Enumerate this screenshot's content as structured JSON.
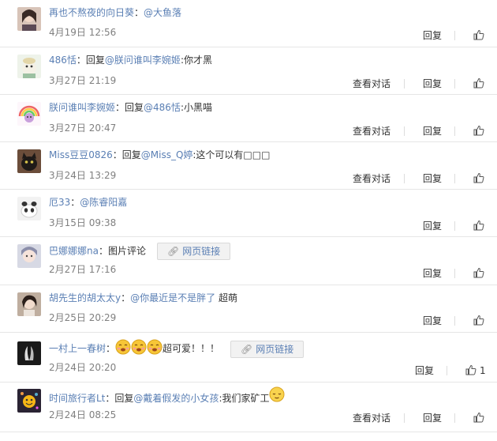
{
  "comments": [
    {
      "user": "再也不熬夜的向日葵",
      "sep": "：",
      "mention": "@大鱼落",
      "after": "",
      "time": "4月19日 12:56",
      "reply": "回复",
      "like_count": ""
    },
    {
      "user": "486恬",
      "sep": "：回复",
      "mention": "@朕问谁叫李婉姬",
      "after": ":你才黑",
      "time": "3月27日 21:19",
      "view": "查看对话",
      "reply": "回复",
      "like_count": ""
    },
    {
      "user": "朕问谁叫李婉姬",
      "sep": "：回复",
      "mention": "@486恬",
      "after": ":小黑喵",
      "time": "3月27日 20:47",
      "view": "查看对话",
      "reply": "回复",
      "like_count": ""
    },
    {
      "user": "Miss豆豆0826",
      "sep": "：回复",
      "mention": "@Miss_Q婷",
      "after": ":这个可以有□□□",
      "time": "3月24日 13:29",
      "view": "查看对话",
      "reply": "回复",
      "like_count": ""
    },
    {
      "user": "厄33",
      "sep": "：",
      "mention": "@陈睿阳嘉",
      "after": "",
      "time": "3月15日 09:38",
      "reply": "回复",
      "like_count": ""
    },
    {
      "user": "巴娜娜娜na",
      "sep": "：图片评论",
      "mention": "",
      "after": "",
      "link": "网页链接",
      "time": "2月27日 17:16",
      "reply": "回复",
      "like_count": ""
    },
    {
      "user": "胡先生的胡太太y",
      "sep": "：",
      "mention": "@你最近是不是胖了",
      "after": " 超萌",
      "time": "2月25日 20:29",
      "reply": "回复",
      "like_count": ""
    },
    {
      "user": "一村上一春树",
      "sep": "：",
      "mention": "",
      "after": "超可爱！！！",
      "link": "网页链接",
      "time": "2月24日 20:20",
      "reply": "回复",
      "like_count": "1"
    },
    {
      "user": "时间旅行者Lt",
      "sep": "：回复",
      "mention": "@戴着假发的小女孩",
      "after": ":我们家矿工",
      "time": "2月24日 08:25",
      "view": "查看对话",
      "reply": "回复",
      "like_count": ""
    }
  ],
  "colors": {
    "link": "#5a7fb4",
    "time": "#808080",
    "divider": "#e6e6e6"
  },
  "icons": {
    "like": "thumbs-up-icon",
    "link": "chain-link-icon",
    "emoji": "smiley-emoji-icon"
  }
}
